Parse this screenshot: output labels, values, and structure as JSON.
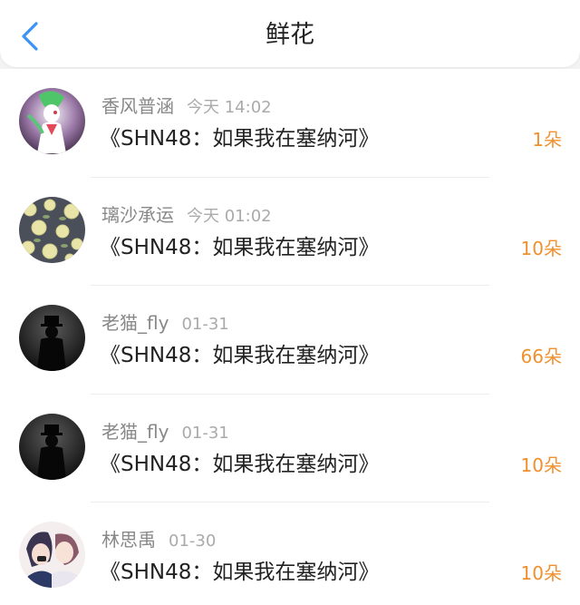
{
  "header": {
    "title": "鲜花",
    "back_icon": "chevron-left-icon"
  },
  "colors": {
    "accent_back": "#3a93f5",
    "count": "#f0902e",
    "name": "#888888",
    "time": "#aaaaaa"
  },
  "records": [
    {
      "name": "香风普涵",
      "time": "今天 14:02",
      "work": "《SHN48：如果我在塞纳河》",
      "count": "1朵",
      "avatar": "character-avatar"
    },
    {
      "name": "璃沙承运",
      "time": "今天 01:02",
      "work": "《SHN48：如果我在塞纳河》",
      "count": "10朵",
      "avatar": "floral-pattern-avatar"
    },
    {
      "name": "老猫_fly",
      "time": "01-31",
      "work": "《SHN48：如果我在塞纳河》",
      "count": "66朵",
      "avatar": "silhouette-avatar"
    },
    {
      "name": "老猫_fly",
      "time": "01-31",
      "work": "《SHN48：如果我在塞纳河》",
      "count": "10朵",
      "avatar": "silhouette-avatar"
    },
    {
      "name": "林思禹",
      "time": "01-30",
      "work": "《SHN48：如果我在塞纳河》",
      "count": "10朵",
      "avatar": "anime-couple-avatar"
    }
  ]
}
